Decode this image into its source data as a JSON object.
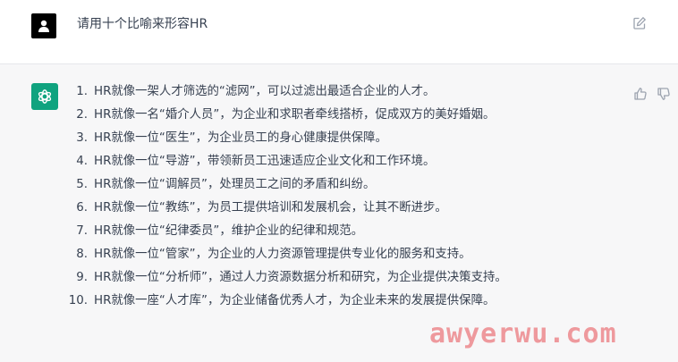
{
  "conversation": {
    "user_message": {
      "avatar_icon": "user-icon",
      "text": "请用十个比喻来形容HR",
      "edit_icon": "edit-icon"
    },
    "assistant_message": {
      "avatar_icon": "openai-logo-icon",
      "accent_color": "#10a37f",
      "items": [
        {
          "num": "1.",
          "text": "HR就像一架人才筛选的“滤网”，可以过滤出最适合企业的人才。"
        },
        {
          "num": "2.",
          "text": "HR就像一名“婚介人员”，为企业和求职者牵线搭桥，促成双方的美好婚姻。"
        },
        {
          "num": "3.",
          "text": "HR就像一位“医生”，为企业员工的身心健康提供保障。"
        },
        {
          "num": "4.",
          "text": "HR就像一位“导游”，带领新员工迅速适应企业文化和工作环境。"
        },
        {
          "num": "5.",
          "text": "HR就像一位“调解员”，处理员工之间的矛盾和纠纷。"
        },
        {
          "num": "6.",
          "text": "HR就像一位“教练”，为员工提供培训和发展机会，让其不断进步。"
        },
        {
          "num": "7.",
          "text": "HR就像一位“纪律委员”，维护企业的纪律和规范。"
        },
        {
          "num": "8.",
          "text": "HR就像一位“管家”，为企业的人力资源管理提供专业化的服务和支持。"
        },
        {
          "num": "9.",
          "text": "HR就像一位“分析师”，通过人力资源数据分析和研究，为企业提供决策支持。"
        },
        {
          "num": "10.",
          "text": "HR就像一座“人才库”，为企业储备优秀人才，为企业未来的发展提供保障。"
        }
      ],
      "feedback_icons": [
        "thumbs-up-icon",
        "thumbs-down-icon"
      ]
    }
  },
  "watermark": {
    "text": "awyerwu.com",
    "color": "#e74c52"
  }
}
